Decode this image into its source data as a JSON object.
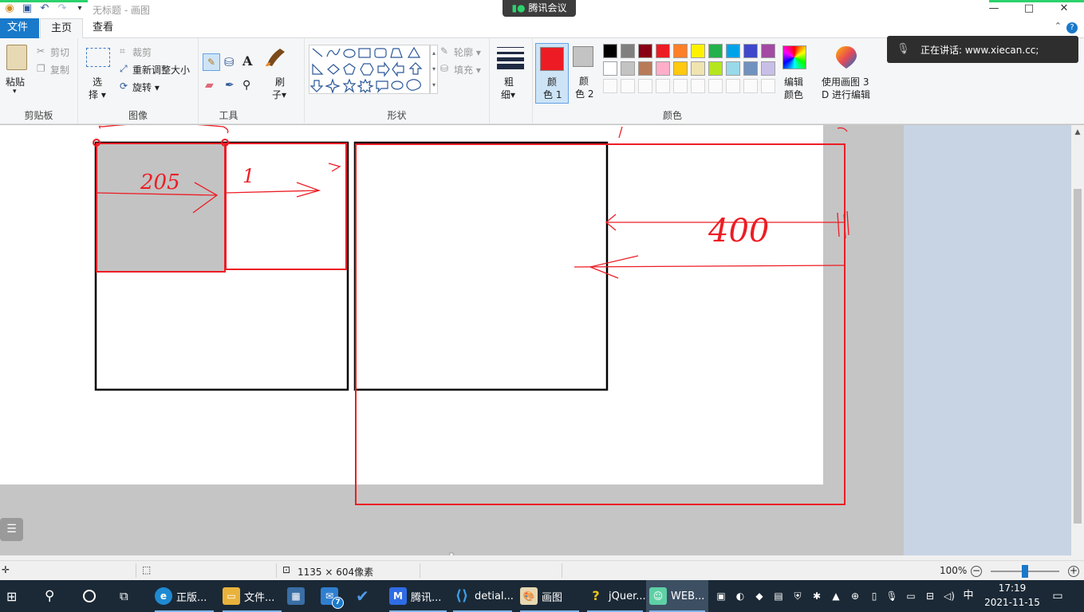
{
  "window": {
    "title": "无标题 - 画图",
    "meeting_tag": "腾讯会议",
    "minimize": "—",
    "maximize": "□",
    "close": "✕"
  },
  "tabs": {
    "file": "文件",
    "home": "主页",
    "view": "查看"
  },
  "ribbon": {
    "clipboard": {
      "label": "剪贴板",
      "paste": "粘贴",
      "cut": "剪切",
      "copy": "复制"
    },
    "image": {
      "label": "图像",
      "select": "选",
      "select2": "择",
      "crop": "裁剪",
      "resize": "重新调整大小",
      "rotate": "旋转"
    },
    "tools": {
      "label": "工具"
    },
    "brushes": {
      "label1": "刷",
      "label2": "子"
    },
    "shapes": {
      "label": "形状",
      "outline": "轮廓",
      "fill": "填充"
    },
    "size": {
      "label1": "粗",
      "label2": "细"
    },
    "color1": {
      "label1": "颜",
      "label2": "色 1",
      "color": "#ed1c24"
    },
    "color2": {
      "label1": "颜",
      "label2": "色 2",
      "color": "#c3c3c3"
    },
    "colors": {
      "label": "颜色",
      "row1": [
        "#000000",
        "#7f7f7f",
        "#880015",
        "#ed1c24",
        "#ff7f27",
        "#fff200",
        "#22b14c",
        "#00a2e8",
        "#3f48cc",
        "#a349a4"
      ],
      "row2": [
        "#ffffff",
        "#c3c3c3",
        "#b97a57",
        "#ffaec9",
        "#ffc90e",
        "#efe4b0",
        "#b5e61d",
        "#99d9ea",
        "#7092be",
        "#c8bfe7"
      ]
    },
    "edit_colors": {
      "label1": "编辑",
      "label2": "颜色"
    },
    "paint3d": {
      "label1": "使用画图 3",
      "label2": "D 进行编辑"
    }
  },
  "speaking": {
    "text": "正在讲话: www.xiecan.cc;"
  },
  "annotations": {
    "n205": "205",
    "n1": "1",
    "n400": "400"
  },
  "status": {
    "dimensions": "1135 × 604像素",
    "zoom": "100%"
  },
  "taskbar": {
    "apps": [
      "正版...",
      "文件...",
      "腾讯...",
      "detial...",
      "画图",
      "jQuer...",
      "WEB..."
    ],
    "mail_badge": "7",
    "ime": "中",
    "time": "17:19",
    "date": "2021-11-15"
  }
}
